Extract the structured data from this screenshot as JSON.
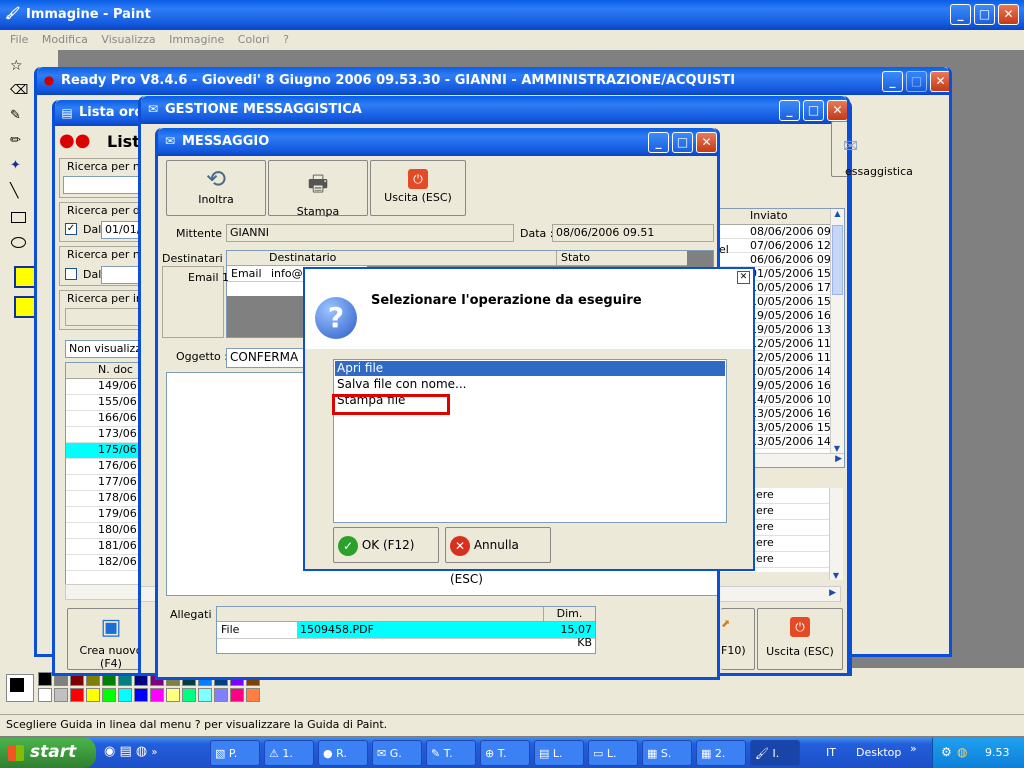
{
  "paint": {
    "title": "Immagine - Paint",
    "menu": [
      "File",
      "Modifica",
      "Visualizza",
      "Immagine",
      "Colori",
      "?"
    ],
    "status": "Scegliere Guida in linea dal menu ? per visualizzare la Guida di Paint."
  },
  "readypro": {
    "title": "Ready Pro V8.4.6 - Giovedi' 8 Giugno 2006  09.53.30 - GIANNI - AMMINISTRAZIONE/ACQUISTI"
  },
  "lista": {
    "title": "Lista ordini",
    "header": "Lista",
    "search_n": "Ricerca per n.c",
    "search_date": "Ricerca per dat",
    "dal_label": "Dal",
    "dal_value": "01/01/",
    "search_num": "Ricerca per nu",
    "dal2_label": "Dal",
    "search_int": "Ricerca per inte",
    "filter": "Non visualizzar",
    "col_ndoc": "N. doc",
    "rows": [
      "149/06",
      "155/06",
      "166/06",
      "173/06",
      "175/06",
      "176/06",
      "177/06",
      "178/06",
      "179/06",
      "180/06",
      "181/06",
      "182/06"
    ],
    "c_label": "C",
    "i_label": "I",
    "in_label": "In",
    "create_label": "Crea nuovo (F4)"
  },
  "gestione": {
    "title": "GESTIONE MESSAGGISTICA",
    "messaggistica_label": "essaggistica",
    "col_inviato": "Inviato",
    "inviato": [
      "08/06/2006 09.",
      "07/06/2006 12.",
      "06/06/2006 09.",
      "01/05/2006 15.",
      "10/05/2006 17.",
      "10/05/2006 15.",
      "19/05/2006 16.",
      "19/05/2006 13.",
      "12/05/2006 11.",
      "12/05/2006 11.",
      "10/05/2006 14.",
      "19/05/2006 16.",
      "14/05/2006 10.",
      "13/05/2006 16.",
      "13/05/2006 15.",
      "13/05/2006 14."
    ],
    "el_label": "el",
    "stato_rows": [
      "dere",
      "dere",
      "dere",
      "dere",
      "dere"
    ],
    "f10_label": "F10)",
    "exit_label": "Uscita (ESC)"
  },
  "messaggio": {
    "title": "MESSAGGIO",
    "btn_forward": "Inoltra",
    "btn_print": "Stampa",
    "btn_exit": "Uscita (ESC)",
    "mittente_label": "Mittente :",
    "mittente": "GIANNI",
    "data_label": "Data :",
    "data": "08/06/2006 09.51",
    "destinatari_label": "Destinatari :",
    "col_dest": "Destinatario",
    "col_stato": "Stato",
    "email1": "Email 1",
    "email_type": "Email",
    "email_val": "info@a",
    "oggetto_label": "Oggetto :",
    "oggetto": "CONFERMA",
    "allegati_label": "Allegati :",
    "col_dim": "Dim.",
    "att_type": "File",
    "att_name": "1509458.PDF",
    "att_size": "15,07 KB"
  },
  "dialog": {
    "question": "Selezionare l'operazione da eseguire",
    "options": [
      "Apri file",
      "Salva file con nome...",
      "Stampa file"
    ],
    "ok": "OK (F12)",
    "cancel": "Annulla (ESC)"
  },
  "taskbar": {
    "start": "start",
    "items": [
      "P.",
      "1.",
      "R.",
      "G.",
      "T.",
      "T.",
      "L.",
      "L.",
      "S.",
      "2.",
      "I."
    ],
    "lang": "IT",
    "desktop": "Desktop",
    "clock": "9.53"
  },
  "colors": {
    "title_blue": "#0a5ee6",
    "taskbar_blue": "#245edb",
    "start_green": "#3c9a3c",
    "selection": "#316ac5",
    "highlight_cyan": "#00ffff",
    "annotation_red": "#e00000"
  }
}
